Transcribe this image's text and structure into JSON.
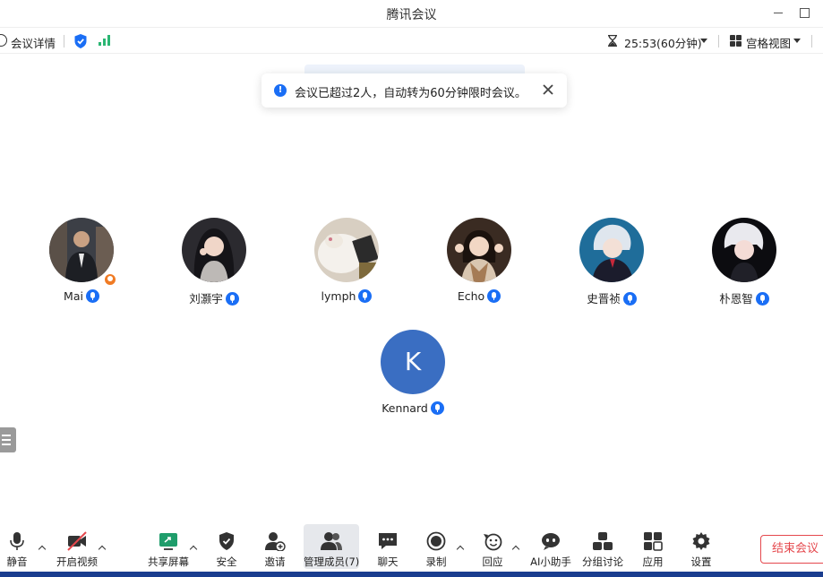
{
  "window": {
    "title": "腾讯会议"
  },
  "topbar": {
    "meeting_info_label": "会议详情",
    "timer_text": "25:53(60分钟)",
    "view_label": "宫格视图"
  },
  "toast": {
    "message": "会议已超过2人，自动转为60分钟限时会议。"
  },
  "participants": [
    {
      "name": "Mai",
      "is_host": true
    },
    {
      "name": "刘灏宇"
    },
    {
      "name": "lymph"
    },
    {
      "name": "Echo"
    },
    {
      "name": "史晋祯"
    },
    {
      "name": "朴恩智"
    },
    {
      "name": "Kennard",
      "avatar_letter": "K"
    }
  ],
  "toolbar": {
    "mute": "静音",
    "video": "开启视频",
    "share": "共享屏幕",
    "security": "安全",
    "invite": "邀请",
    "members": "管理成员(7)",
    "chat": "聊天",
    "record": "录制",
    "react": "回应",
    "ai": "AI小助手",
    "breakout": "分组讨论",
    "apps": "应用",
    "settings": "设置",
    "end": "结束会议"
  },
  "colors": {
    "accent": "#1a6ef5",
    "end": "#e5484d",
    "host_badge": "#f07b24",
    "letter_avatar": "#3a6ec2",
    "bottom_bar": "#1a3d8f"
  }
}
